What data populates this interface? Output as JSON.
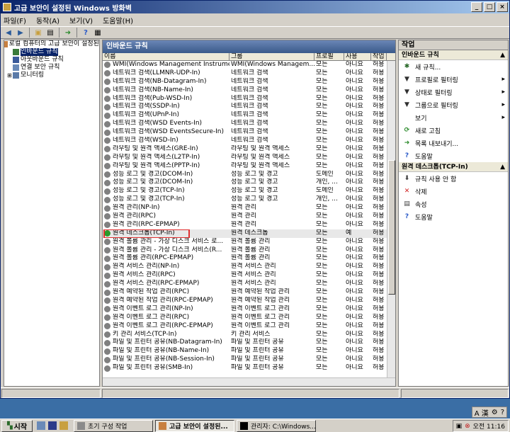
{
  "window": {
    "title": "고급 보안이 설정된 Windows 방화벽"
  },
  "menu": [
    "파일(F)",
    "동작(A)",
    "보기(V)",
    "도움말(H)"
  ],
  "tree": {
    "root": "로컬 컴퓨터의 고급 보안이 설정된",
    "items": [
      "인바운드 규칙",
      "아웃바운드 규칙",
      "연결 보안 규칙",
      "모니터링"
    ]
  },
  "center": {
    "title": "인바운드 규칙",
    "columns": [
      "이름",
      "그룹",
      "프로필",
      "사용",
      "작업"
    ],
    "rows": [
      {
        "name": "WMI(Windows Management Instrume...",
        "group": "WMI(Windows Managem...",
        "profile": "모든",
        "enabled": "아니요",
        "action": "허용",
        "on": false
      },
      {
        "name": "네트워크 검색(LLMNR-UDP-In)",
        "group": "네트워크 검색",
        "profile": "모든",
        "enabled": "아니요",
        "action": "허용",
        "on": false
      },
      {
        "name": "네트워크 검색(NB-Datagram-In)",
        "group": "네트워크 검색",
        "profile": "모든",
        "enabled": "아니요",
        "action": "허용",
        "on": false
      },
      {
        "name": "네트워크 검색(NB-Name-In)",
        "group": "네트워크 검색",
        "profile": "모든",
        "enabled": "아니요",
        "action": "허용",
        "on": false
      },
      {
        "name": "네트워크 검색(Pub-WSD-In)",
        "group": "네트워크 검색",
        "profile": "모든",
        "enabled": "아니요",
        "action": "허용",
        "on": false
      },
      {
        "name": "네트워크 검색(SSDP-In)",
        "group": "네트워크 검색",
        "profile": "모든",
        "enabled": "아니요",
        "action": "허용",
        "on": false
      },
      {
        "name": "네트워크 검색(UPnP-In)",
        "group": "네트워크 검색",
        "profile": "모든",
        "enabled": "아니요",
        "action": "허용",
        "on": false
      },
      {
        "name": "네트워크 검색(WSD Events-In)",
        "group": "네트워크 검색",
        "profile": "모든",
        "enabled": "아니요",
        "action": "허용",
        "on": false
      },
      {
        "name": "네트워크 검색(WSD EventsSecure-In)",
        "group": "네트워크 검색",
        "profile": "모든",
        "enabled": "아니요",
        "action": "허용",
        "on": false
      },
      {
        "name": "네트워크 검색(WSD-In)",
        "group": "네트워크 검색",
        "profile": "모든",
        "enabled": "아니요",
        "action": "허용",
        "on": false
      },
      {
        "name": "라우팅 및 원격 액세스(GRE-In)",
        "group": "라우팅 및 원격 액세스",
        "profile": "모든",
        "enabled": "아니요",
        "action": "허용",
        "on": false
      },
      {
        "name": "라우팅 및 원격 액세스(L2TP-In)",
        "group": "라우팅 및 원격 액세스",
        "profile": "모든",
        "enabled": "아니요",
        "action": "허용",
        "on": false
      },
      {
        "name": "라우팅 및 원격 액세스(PPTP-In)",
        "group": "라우팅 및 원격 액세스",
        "profile": "모든",
        "enabled": "아니요",
        "action": "허용",
        "on": false
      },
      {
        "name": "성능 로그 및 경고(DCOM-In)",
        "group": "성능 로그 및 경고",
        "profile": "도메인",
        "enabled": "아니요",
        "action": "허용",
        "on": false
      },
      {
        "name": "성능 로그 및 경고(DCOM-In)",
        "group": "성능 로그 및 경고",
        "profile": "개인, ...",
        "enabled": "아니요",
        "action": "허용",
        "on": false
      },
      {
        "name": "성능 로그 및 경고(TCP-In)",
        "group": "성능 로그 및 경고",
        "profile": "도메인",
        "enabled": "아니요",
        "action": "허용",
        "on": false
      },
      {
        "name": "성능 로그 및 경고(TCP-In)",
        "group": "성능 로그 및 경고",
        "profile": "개인, ...",
        "enabled": "아니요",
        "action": "허용",
        "on": false
      },
      {
        "name": "원격 관리(NP-In)",
        "group": "원격 관리",
        "profile": "모든",
        "enabled": "아니요",
        "action": "허용",
        "on": false
      },
      {
        "name": "원격 관리(RPC)",
        "group": "원격 관리",
        "profile": "모든",
        "enabled": "아니요",
        "action": "허용",
        "on": false
      },
      {
        "name": "원격 관리(RPC-EPMAP)",
        "group": "원격 관리",
        "profile": "모든",
        "enabled": "아니요",
        "action": "허용",
        "on": false
      },
      {
        "name": "원격 데스크톱(TCP-In)",
        "group": "원격 데스크톱",
        "profile": "모든",
        "enabled": "예",
        "action": "허용",
        "on": true
      },
      {
        "name": "원격 볼륨 관리 - 가상 디스크 서비스 로...",
        "group": "원격 볼륨 관리",
        "profile": "모든",
        "enabled": "아니요",
        "action": "허용",
        "on": false
      },
      {
        "name": "원격 볼륨 관리 - 가상 디스크 서비스(R...",
        "group": "원격 볼륨 관리",
        "profile": "모든",
        "enabled": "아니요",
        "action": "허용",
        "on": false
      },
      {
        "name": "원격 볼륨 관리(RPC-EPMAP)",
        "group": "원격 볼륨 관리",
        "profile": "모든",
        "enabled": "아니요",
        "action": "허용",
        "on": false
      },
      {
        "name": "원격 서비스 관리(NP-In)",
        "group": "원격 서비스 관리",
        "profile": "모든",
        "enabled": "아니요",
        "action": "허용",
        "on": false
      },
      {
        "name": "원격 서비스 관리(RPC)",
        "group": "원격 서비스 관리",
        "profile": "모든",
        "enabled": "아니요",
        "action": "허용",
        "on": false
      },
      {
        "name": "원격 서비스 관리(RPC-EPMAP)",
        "group": "원격 서비스 관리",
        "profile": "모든",
        "enabled": "아니요",
        "action": "허용",
        "on": false
      },
      {
        "name": "원격 예약된 작업 관리(RPC)",
        "group": "원격 예약된 작업 관리",
        "profile": "모든",
        "enabled": "아니요",
        "action": "허용",
        "on": false
      },
      {
        "name": "원격 예약된 작업 관리(RPC-EPMAP)",
        "group": "원격 예약된 작업 관리",
        "profile": "모든",
        "enabled": "아니요",
        "action": "허용",
        "on": false
      },
      {
        "name": "원격 이벤트 로그 관리(NP-In)",
        "group": "원격 이벤트 로그 관리",
        "profile": "모든",
        "enabled": "아니요",
        "action": "허용",
        "on": false
      },
      {
        "name": "원격 이벤트 로그 관리(RPC)",
        "group": "원격 이벤트 로그 관리",
        "profile": "모든",
        "enabled": "아니요",
        "action": "허용",
        "on": false
      },
      {
        "name": "원격 이벤트 로그 관리(RPC-EPMAP)",
        "group": "원격 이벤트 로그 관리",
        "profile": "모든",
        "enabled": "아니요",
        "action": "허용",
        "on": false
      },
      {
        "name": "키 관리 서비스(TCP-In)",
        "group": "키 관리 서비스",
        "profile": "모든",
        "enabled": "아니요",
        "action": "허용",
        "on": false
      },
      {
        "name": "파일 및 프린터 공유(NB-Datagram-In)",
        "group": "파일 및 프린터 공유",
        "profile": "모든",
        "enabled": "아니요",
        "action": "허용",
        "on": false
      },
      {
        "name": "파일 및 프린터 공유(NB-Name-In)",
        "group": "파일 및 프린터 공유",
        "profile": "모든",
        "enabled": "아니요",
        "action": "허용",
        "on": false
      },
      {
        "name": "파일 및 프린터 공유(NB-Session-In)",
        "group": "파일 및 프린터 공유",
        "profile": "모든",
        "enabled": "아니요",
        "action": "허용",
        "on": false
      },
      {
        "name": "파일 및 프린터 공유(SMB-In)",
        "group": "파일 및 프린터 공유",
        "profile": "모든",
        "enabled": "아니요",
        "action": "허용",
        "on": false
      }
    ],
    "highlight_index": 20
  },
  "actions": {
    "title": "작업",
    "sec1": "인바운드 규칙",
    "items1": [
      {
        "label": "새 규칙...",
        "icon": "new-rule-icon",
        "arrow": false
      },
      {
        "label": "프로필로 필터링",
        "icon": "filter-icon",
        "arrow": true
      },
      {
        "label": "상태로 필터링",
        "icon": "filter-icon",
        "arrow": true
      },
      {
        "label": "그룹으로 필터링",
        "icon": "filter-icon",
        "arrow": true
      },
      {
        "label": "보기",
        "icon": "",
        "arrow": true
      },
      {
        "label": "새로 고침",
        "icon": "refresh-icon",
        "arrow": false
      },
      {
        "label": "목록 내보내기...",
        "icon": "export-icon",
        "arrow": false
      },
      {
        "label": "도움말",
        "icon": "help-icon",
        "arrow": false
      }
    ],
    "sec2": "원격 데스크톱(TCP-In)",
    "items2": [
      {
        "label": "규칙 사용 안 함",
        "icon": "disable-icon",
        "arrow": false
      },
      {
        "label": "삭제",
        "icon": "delete-icon",
        "arrow": false
      },
      {
        "label": "속성",
        "icon": "properties-icon",
        "arrow": false
      },
      {
        "label": "도움말",
        "icon": "help-icon",
        "arrow": false
      }
    ]
  },
  "taskbar": {
    "start": "시작",
    "tasks": [
      "초기 구성 작업",
      "고급 보안이 설정된...",
      "관리자: C:\\Windows..."
    ],
    "time": "오전 11:16",
    "lang": "A 漢"
  }
}
